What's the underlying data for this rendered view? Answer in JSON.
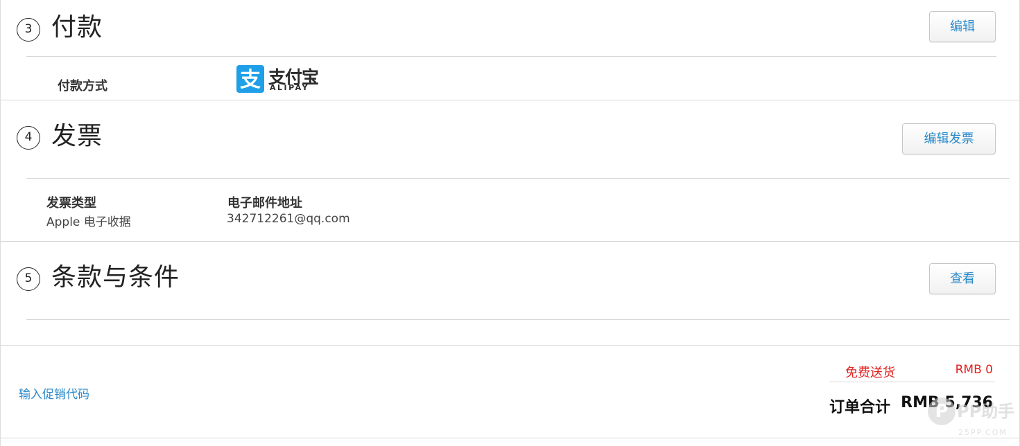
{
  "payment": {
    "step": "3",
    "title": "付款",
    "edit_label": "编辑",
    "method_label": "付款方式",
    "alipay_cn": "支付宝",
    "alipay_en": "ALIPAY"
  },
  "invoice": {
    "step": "4",
    "title": "发票",
    "edit_label": "编辑发票",
    "type_label": "发票类型",
    "type_value": "Apple 电子收据",
    "email_label": "电子邮件地址",
    "email_value": "342712261@qq.com"
  },
  "terms": {
    "step": "5",
    "title": "条款与条件",
    "view_label": "查看"
  },
  "summary": {
    "promo_link": "输入促销代码",
    "shipping_label": "免费送货",
    "shipping_value": "RMB 0",
    "total_label": "订单合计",
    "total_value": "RMB 5,736"
  },
  "watermark": {
    "logo_letter": "P",
    "text": "PP助手",
    "sub": "25PP.COM"
  },
  "colors": {
    "link_blue": "#2b8ac9",
    "alipay_blue": "#1e9fe8",
    "shipping_red": "#e02020"
  }
}
